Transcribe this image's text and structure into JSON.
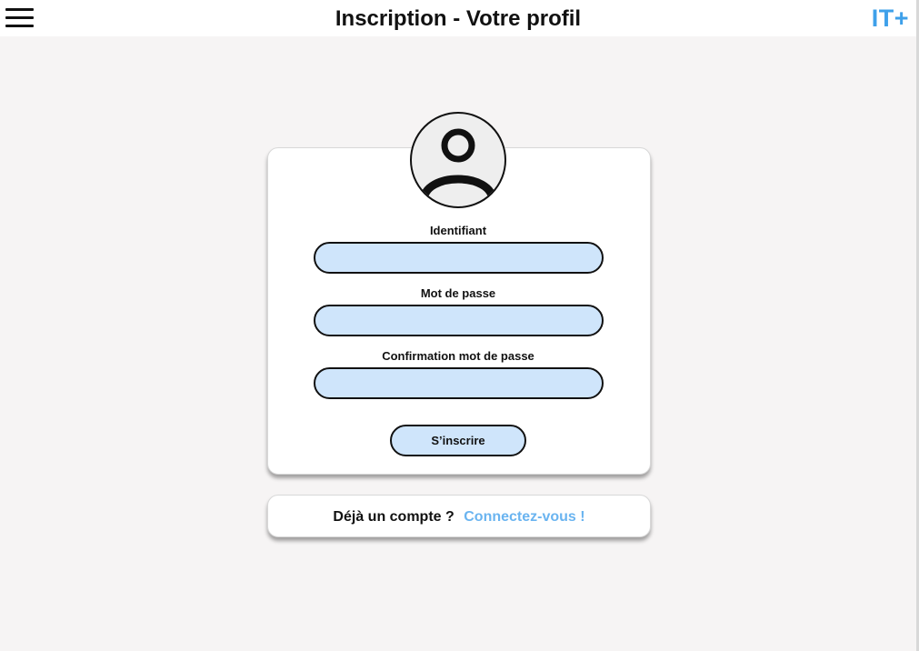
{
  "header": {
    "title": "Inscription - Votre profil",
    "logo": "IT+",
    "menu_icon": "hamburger-menu-icon"
  },
  "profile": {
    "avatar_icon": "user-avatar-icon"
  },
  "form": {
    "identifiant_label": "Identifiant",
    "identifiant_value": "",
    "password_label": "Mot de passe",
    "password_value": "",
    "confirm_label": "Confirmation mot de passe",
    "confirm_value": "",
    "submit_label": "S’inscrire"
  },
  "login_prompt": {
    "question": "Déjà un compte ?",
    "link": "Connectez-vous !"
  },
  "colors": {
    "accent": "#3ea0ea",
    "link": "#6ab4f0",
    "input_fill": "#cfe5fb",
    "background": "#f6f4f4"
  }
}
